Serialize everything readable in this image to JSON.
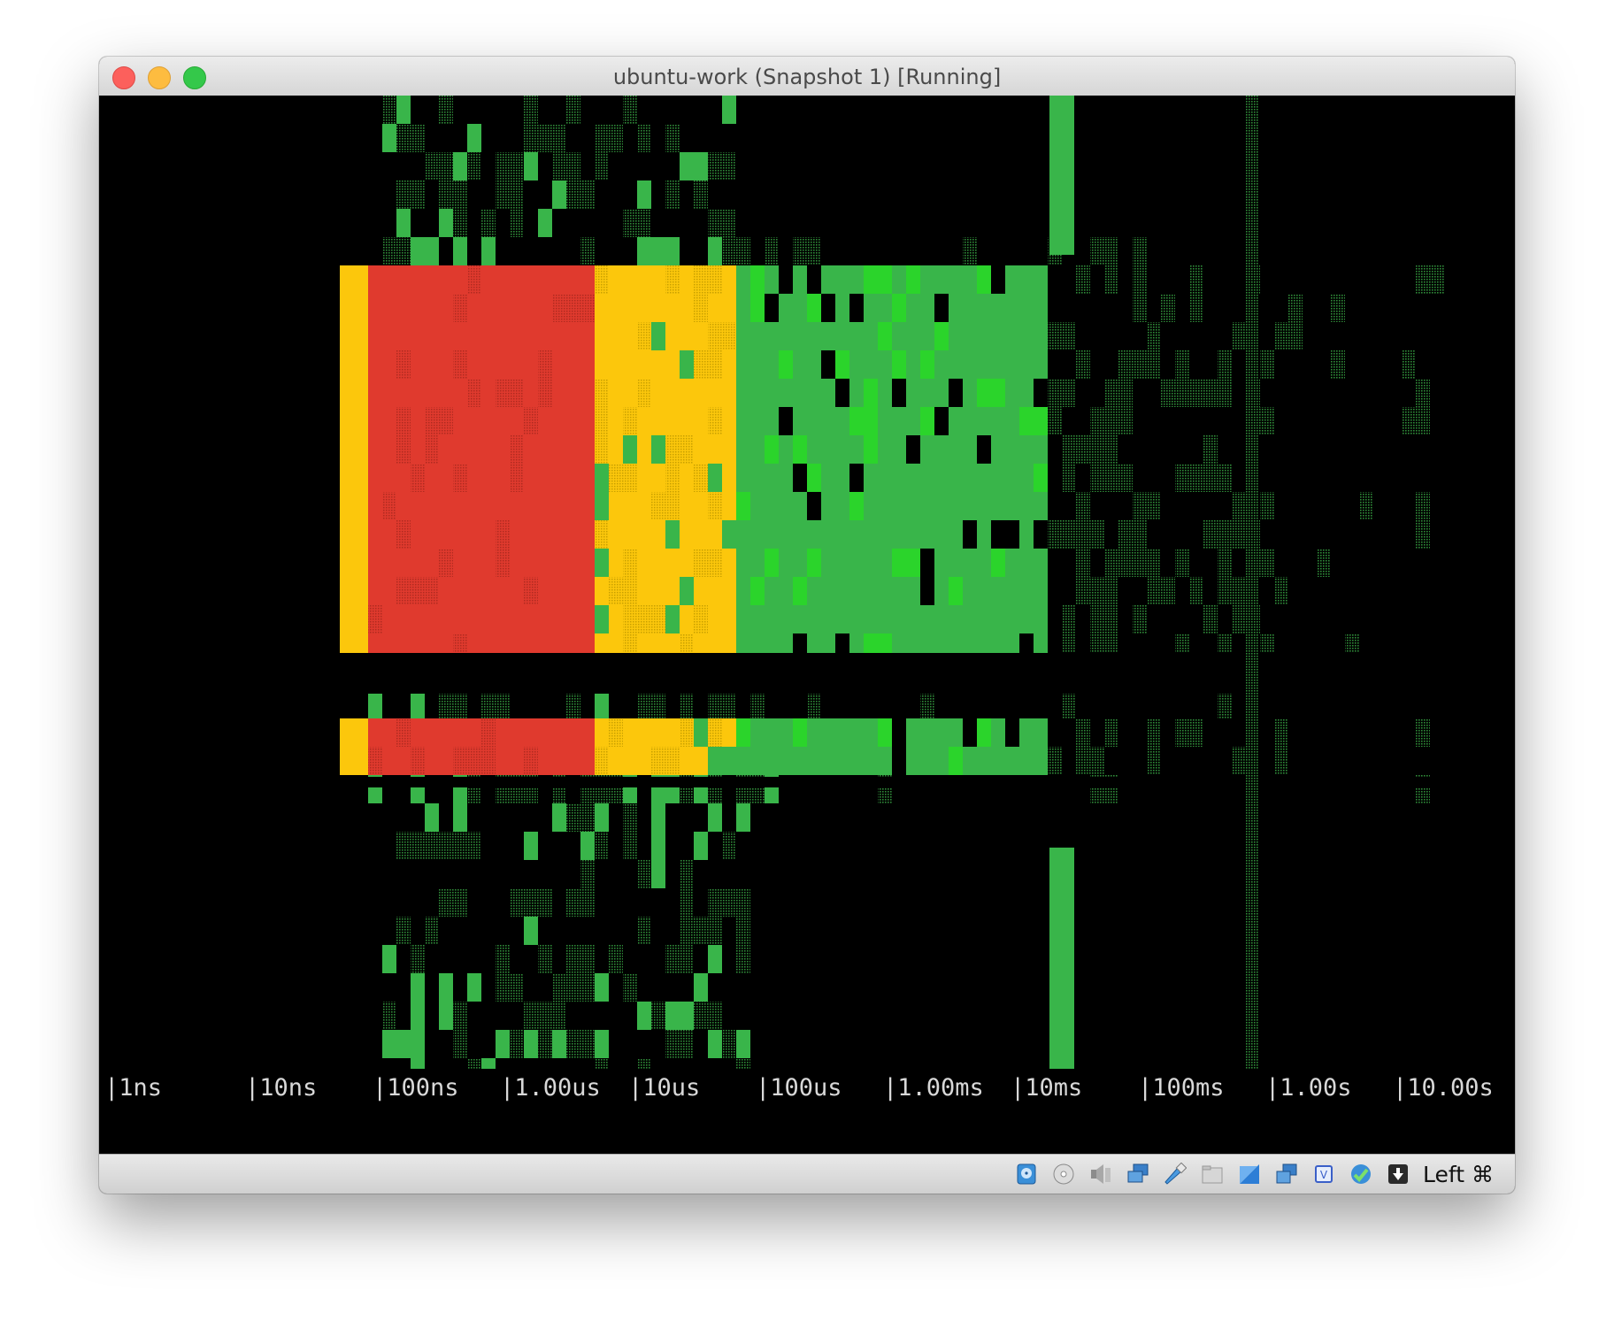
{
  "window": {
    "title": "ubuntu-work (Snapshot 1) [Running]",
    "host_key": "Left ⌘"
  },
  "axis": {
    "ticks": [
      "|1ns",
      "|10ns",
      "|100ns",
      "|1.00us",
      "|10us",
      "|100us",
      "|1.00ms",
      "|10ms",
      "|100ms",
      "|1.00s",
      "|10.00s"
    ]
  },
  "colors": {
    "red": "#e03a2e",
    "yellow": "#fcc70c",
    "green": "#39b54a",
    "bright_green": "#2bd42b",
    "dim_green": "#2a8a35",
    "background": "#000000"
  },
  "status_icons": [
    "hard-disk-icon",
    "optical-disk-icon",
    "audio-icon",
    "network-icon",
    "usb-icon",
    "shared-folders-icon",
    "display-icon",
    "video-capture-icon",
    "cpu-icon",
    "guest-additions-icon",
    "keyboard-capture-icon"
  ]
}
